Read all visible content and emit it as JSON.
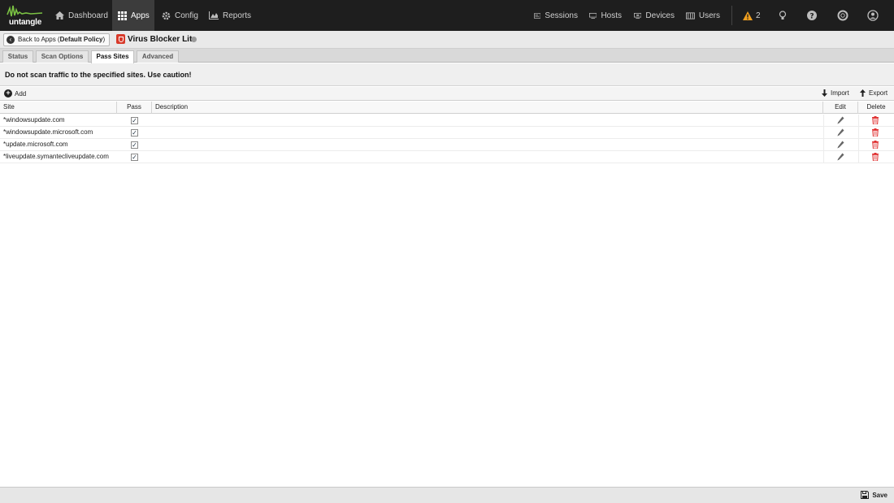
{
  "topbar": {
    "logo_text": "untangle",
    "nav": [
      {
        "label": "Dashboard",
        "icon": "home-icon"
      },
      {
        "label": "Apps",
        "icon": "grid-icon",
        "active": true
      },
      {
        "label": "Config",
        "icon": "gear-icon"
      },
      {
        "label": "Reports",
        "icon": "chart-icon"
      }
    ],
    "right_nav": [
      {
        "label": "Sessions",
        "icon": "sessions-icon"
      },
      {
        "label": "Hosts",
        "icon": "hosts-icon"
      },
      {
        "label": "Devices",
        "icon": "devices-icon"
      },
      {
        "label": "Users",
        "icon": "users-icon"
      }
    ],
    "alerts_count": "2",
    "colors": {
      "bg": "#1e1e1e",
      "active": "#3c3c3c",
      "logo_green": "#7ac143",
      "alert": "#f0a020"
    }
  },
  "subbar": {
    "back_label": "Back to Apps (",
    "back_policy": "Default Policy",
    "back_close": ")",
    "app_title": "Virus Blocker Lite"
  },
  "tabs": [
    {
      "label": "Status"
    },
    {
      "label": "Scan Options"
    },
    {
      "label": "Pass Sites",
      "active": true
    },
    {
      "label": "Advanced"
    }
  ],
  "message": "Do not scan traffic to the specified sites. Use caution!",
  "toolbar": {
    "add": "Add",
    "import": "Import",
    "export": "Export"
  },
  "grid": {
    "columns": {
      "site": "Site",
      "pass": "Pass",
      "description": "Description",
      "edit": "Edit",
      "delete": "Delete"
    },
    "rows": [
      {
        "site": "*windowsupdate.com",
        "pass": true,
        "description": ""
      },
      {
        "site": "*windowsupdate.microsoft.com",
        "pass": true,
        "description": ""
      },
      {
        "site": "*update.microsoft.com",
        "pass": true,
        "description": ""
      },
      {
        "site": "*liveupdate.symantecliveupdate.com",
        "pass": true,
        "description": ""
      }
    ],
    "colors": {
      "delete": "#e03030"
    }
  },
  "footer": {
    "save": "Save"
  }
}
